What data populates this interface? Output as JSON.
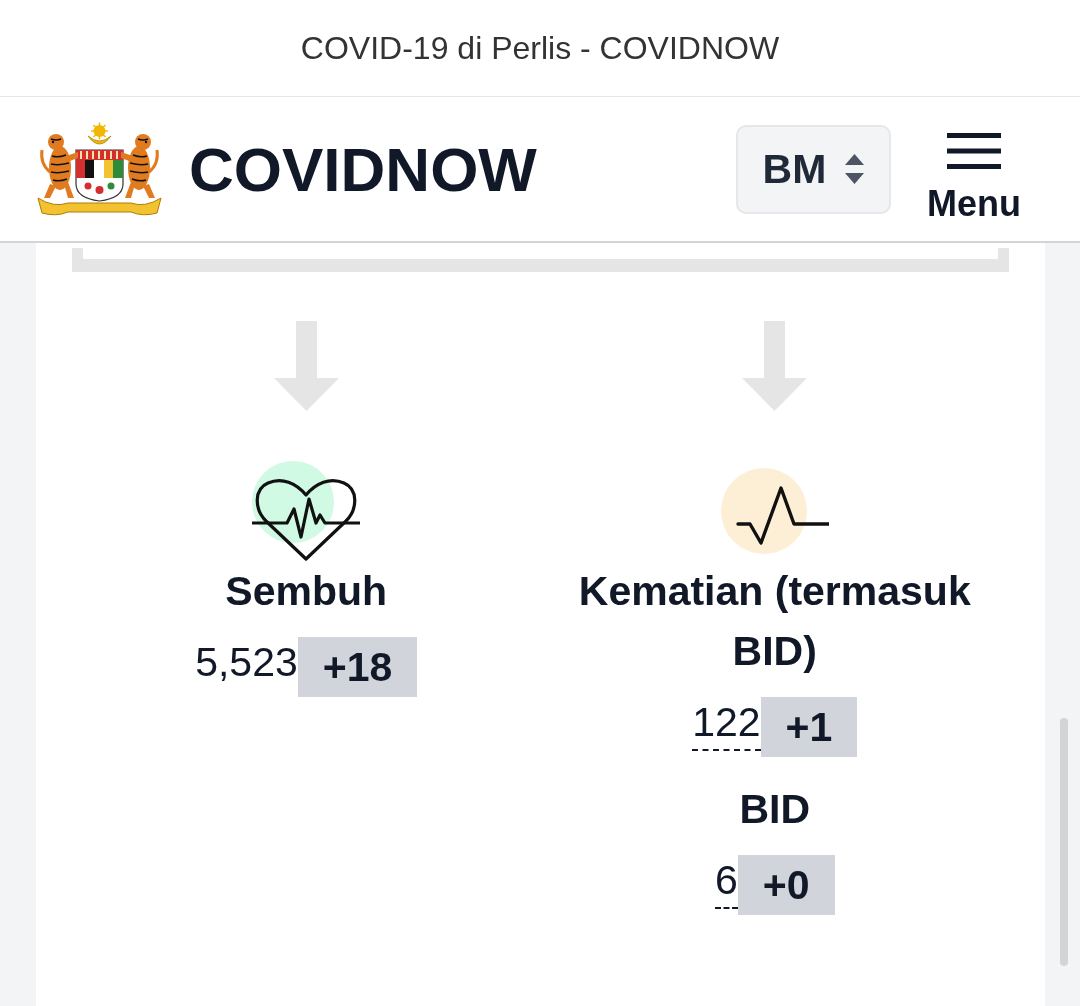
{
  "browser": {
    "title": "COVID-19 di Perlis - COVIDNOW"
  },
  "header": {
    "brand": "COVIDNOW",
    "language": "BM",
    "menu_label": "Menu"
  },
  "columns": [
    {
      "kind": "recovered",
      "entries": [
        {
          "label": "Sembuh",
          "value": "5,523",
          "change": "+18",
          "underlined": false
        }
      ]
    },
    {
      "kind": "deaths",
      "entries": [
        {
          "label": "Kematian (termasuk BID)",
          "value": "122",
          "change": "+1",
          "underlined": true
        },
        {
          "label": "BID",
          "value": "6",
          "change": "+0",
          "underlined": true
        }
      ]
    }
  ]
}
